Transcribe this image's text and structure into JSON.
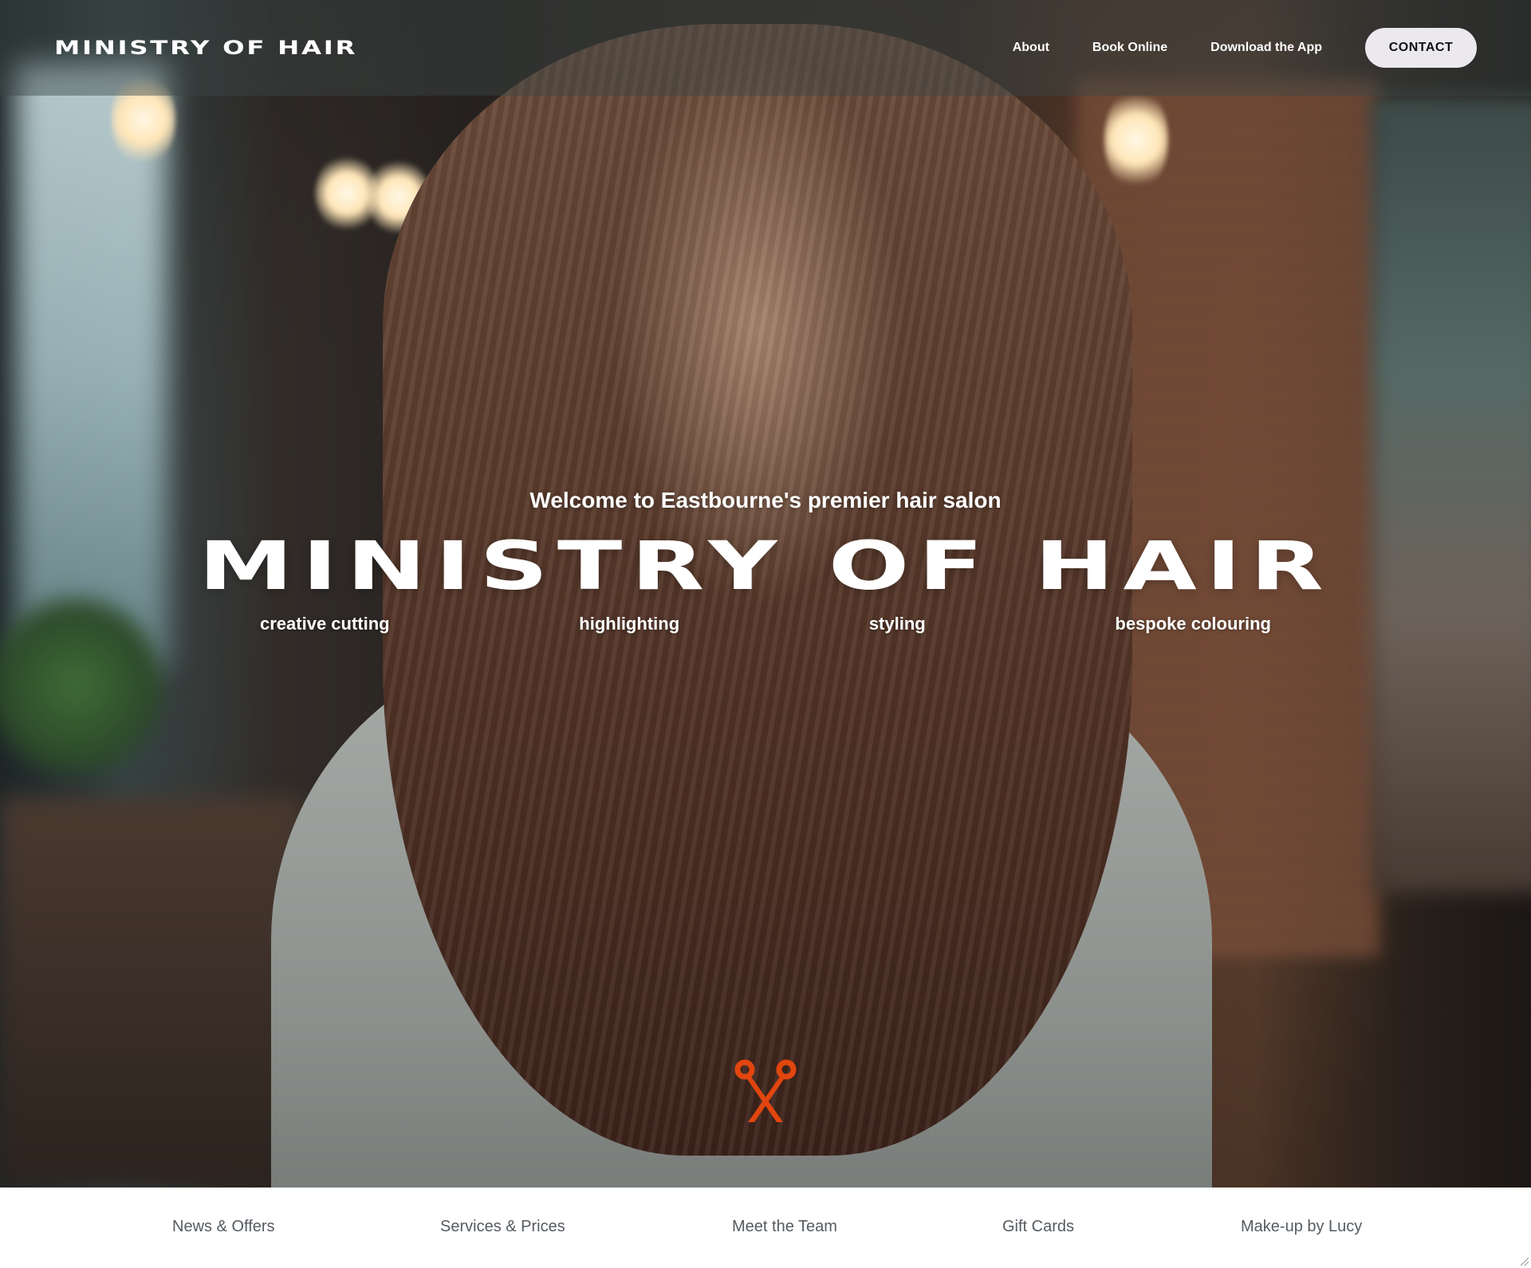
{
  "header": {
    "logo_text": "MINISTRY OF HAIR",
    "nav": [
      {
        "label": "About"
      },
      {
        "label": "Book Online"
      },
      {
        "label": "Download the App"
      }
    ],
    "contact_label": "CONTACT"
  },
  "hero": {
    "welcome": "Welcome to Eastbourne's premier hair salon",
    "title": "MINISTRY OF HAIR",
    "services": [
      "creative cutting",
      "highlighting",
      "styling",
      "bespoke colouring"
    ],
    "scroll_icon": "scissors-icon",
    "accent_color": "#e2450e"
  },
  "subnav": {
    "items": [
      {
        "label": "News & Offers"
      },
      {
        "label": "Services & Prices"
      },
      {
        "label": "Meet the Team"
      },
      {
        "label": "Gift Cards"
      },
      {
        "label": "Make-up by Lucy"
      }
    ]
  }
}
